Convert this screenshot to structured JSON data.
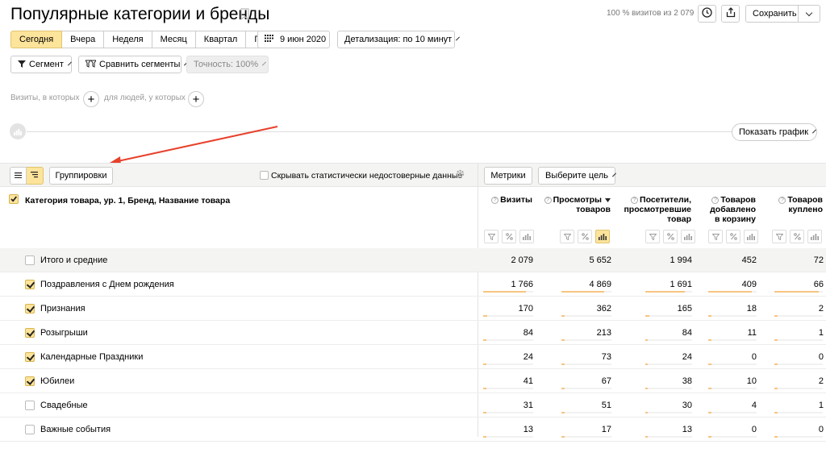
{
  "header": {
    "title": "Популярные категории и бренды",
    "visits_info": "100 % визитов из 2 079",
    "save_label": "Сохранить"
  },
  "periods": {
    "items": [
      "Сегодня",
      "Вчера",
      "Неделя",
      "Месяц",
      "Квартал",
      "Год"
    ],
    "active": "Сегодня",
    "date_label": "9 июн 2020",
    "detail_label": "Детализация: по 10 минут"
  },
  "filters": {
    "segment_label": "Сегмент",
    "compare_label": "Сравнить сегменты",
    "accuracy_label": "Точность: 100%"
  },
  "conditions": {
    "visits_label": "Визиты, в которых",
    "people_label": "для людей, у которых"
  },
  "chart": {
    "show_label": "Показать график"
  },
  "toolbar": {
    "grouping_label": "Группировки",
    "hide_unreliable_label": "Скрывать статистически недостоверные данные",
    "metrics_label": "Метрики",
    "goal_label": "Выберите цель"
  },
  "table": {
    "dimension_header": "Категория товара, ур. 1, Бренд, Название товара",
    "columns": [
      "Визиты",
      "Просмотры товаров",
      "Посетители, просмотревшие товар",
      "Товаров добавлено в корзину",
      "Товаров куплено"
    ],
    "col_lines": [
      [
        "Визиты"
      ],
      [
        "Просмотры",
        "товаров"
      ],
      [
        "Посетители,",
        "просмотревшие",
        "товар"
      ],
      [
        "Товаров",
        "добавлено",
        "в корзину"
      ],
      [
        "Товаров",
        "куплено"
      ]
    ],
    "sorted_column": 1,
    "active_chart_column": 1,
    "totals": {
      "label": "Итого и средние",
      "values": [
        "2 079",
        "5 652",
        "1 994",
        "452",
        "72"
      ]
    },
    "rows": [
      {
        "label": "Поздравления с Днем рождения",
        "checked": true,
        "values": [
          "1 766",
          "4 869",
          "1 691",
          "409",
          "66"
        ],
        "shares": [
          0.849,
          0.861,
          0.848,
          0.905,
          0.917
        ]
      },
      {
        "label": "Признания",
        "checked": true,
        "values": [
          "170",
          "362",
          "165",
          "18",
          "2"
        ],
        "shares": [
          0.082,
          0.064,
          0.083,
          0.04,
          0.028
        ]
      },
      {
        "label": "Розыгрыши",
        "checked": true,
        "values": [
          "84",
          "213",
          "84",
          "11",
          "1"
        ],
        "shares": [
          0.04,
          0.038,
          0.042,
          0.024,
          0.014
        ]
      },
      {
        "label": "Календарные Праздники",
        "checked": true,
        "values": [
          "24",
          "73",
          "24",
          "0",
          "0"
        ],
        "shares": [
          0.012,
          0.013,
          0.012,
          0,
          0
        ]
      },
      {
        "label": "Юбилеи",
        "checked": true,
        "values": [
          "41",
          "67",
          "38",
          "10",
          "2"
        ],
        "shares": [
          0.02,
          0.012,
          0.019,
          0.022,
          0.028
        ]
      },
      {
        "label": "Свадебные",
        "checked": false,
        "values": [
          "31",
          "51",
          "30",
          "4",
          "1"
        ],
        "shares": [
          0.015,
          0.009,
          0.015,
          0.009,
          0.014
        ]
      },
      {
        "label": "Важные события",
        "checked": false,
        "values": [
          "13",
          "17",
          "13",
          "0",
          "0"
        ],
        "shares": [
          0.006,
          0.003,
          0.007,
          0,
          0
        ]
      }
    ]
  },
  "colors": {
    "accent": "#fde49b",
    "bar": "#f7c482",
    "arrow": "#e8412c"
  },
  "icons": [
    "bookmark-icon",
    "clock-icon",
    "share-icon",
    "calendar-icon",
    "filter-icon",
    "compare-icon",
    "chart-icon",
    "list-view-icon",
    "tree-view-icon",
    "gear-icon",
    "help-icon",
    "percent-icon",
    "checkbox-icon"
  ]
}
